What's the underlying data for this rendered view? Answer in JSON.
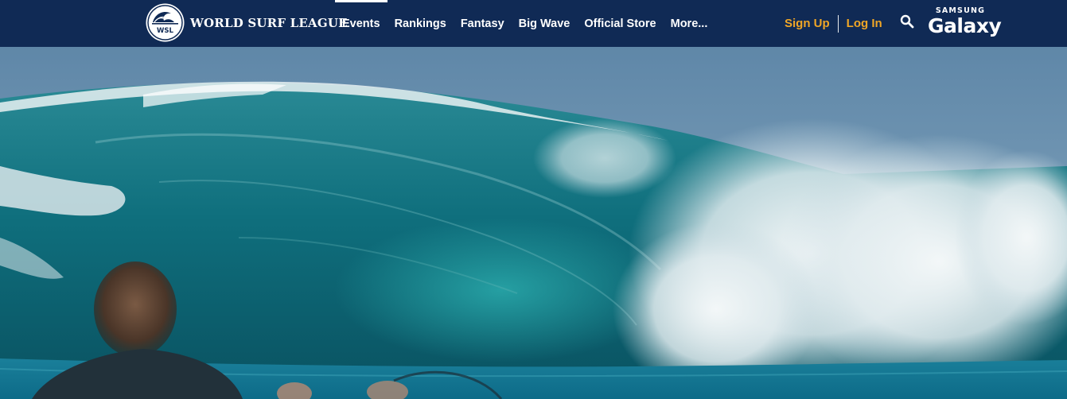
{
  "brand": {
    "logo_text": "WSL",
    "name": "WORLD SURF LEAGUE"
  },
  "nav": {
    "items": [
      {
        "label": "Events",
        "active": true
      },
      {
        "label": "Rankings",
        "active": false
      },
      {
        "label": "Fantasy",
        "active": false
      },
      {
        "label": "Big Wave",
        "active": false
      },
      {
        "label": "Official Store",
        "active": false
      },
      {
        "label": "More...",
        "active": false
      }
    ]
  },
  "auth": {
    "signup_label": "Sign Up",
    "login_label": "Log In"
  },
  "search": {
    "icon": "search-icon"
  },
  "sponsor": {
    "top": "SAMSUNG",
    "bottom": "Galaxy"
  },
  "colors": {
    "header_bg": "#102a55",
    "accent_orange": "#f0a626",
    "nav_text": "#ffffff"
  },
  "hero": {
    "image": "large turquoise wave breaking with a surfer watching from the water"
  }
}
